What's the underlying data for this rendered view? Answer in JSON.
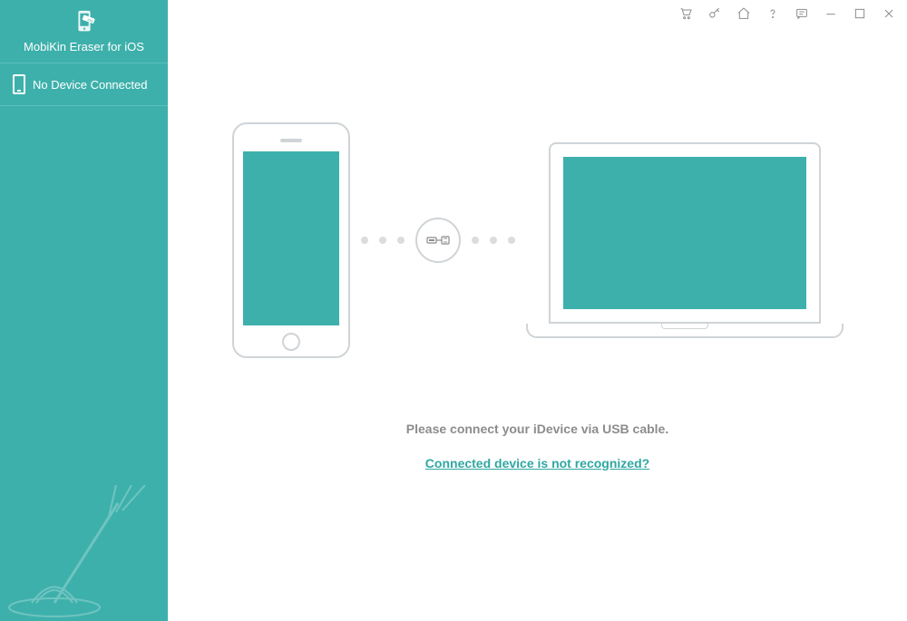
{
  "app": {
    "title": "MobiKin Eraser for iOS"
  },
  "sidebar": {
    "device_status": "No Device Connected"
  },
  "titlebar": {
    "icons": {
      "cart": "cart-icon",
      "key": "key-icon",
      "home": "home-icon",
      "help": "help-icon",
      "feedback": "feedback-icon",
      "minimize": "minimize-icon",
      "maximize": "maximize-icon",
      "close": "close-icon"
    }
  },
  "main": {
    "instruction": "Please connect your iDevice via USB cable.",
    "help_link": "Connected device is not recognized?"
  },
  "colors": {
    "brand": "#3eb0ab",
    "muted": "#8c8c8c",
    "outline": "#cfd4d7"
  }
}
